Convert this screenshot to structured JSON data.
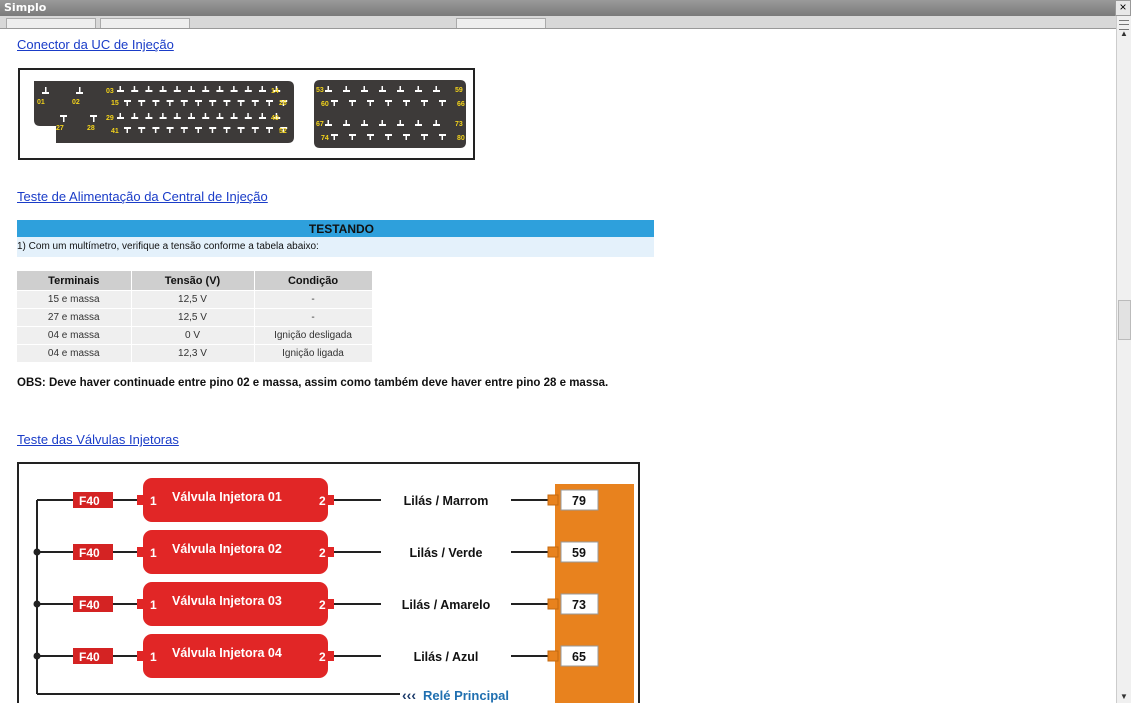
{
  "window": {
    "title": "Simplo",
    "close_label": "×"
  },
  "links": {
    "connector": "Conector da UC de Injeção",
    "power_test": "Teste de Alimentação da Central de Injeção",
    "injector_test": "Teste das Válvulas Injetoras"
  },
  "connector": {
    "left_labels": [
      "03",
      "14",
      "15",
      "26",
      "29",
      "40",
      "41",
      "52",
      "01",
      "02",
      "27",
      "28"
    ],
    "right_labels": [
      "53",
      "59",
      "60",
      "66",
      "67",
      "73",
      "74",
      "80"
    ]
  },
  "testing": {
    "header": "TESTANDO",
    "instruction": "1) Com um multímetro, verifique a tensão conforme a tabela abaixo:"
  },
  "voltage_table": {
    "headers": [
      "Terminais",
      "Tensão (V)",
      "Condição"
    ],
    "rows": [
      [
        "15 e massa",
        "12,5 V",
        "-"
      ],
      [
        "27 e massa",
        "12,5 V",
        "-"
      ],
      [
        "04 e massa",
        "0 V",
        "Ignição desligada"
      ],
      [
        "04 e massa",
        "12,3 V",
        "Ignição ligada"
      ]
    ]
  },
  "obs": "OBS: Deve haver continuade entre pino 02 e massa, assim como também deve haver entre pino 28 e massa.",
  "injectors": {
    "fuse": "F40",
    "pin_in": "1",
    "pin_out": "2",
    "rows": [
      {
        "name": "Válvula Injetora 01",
        "wire": "Lilás / Marrom",
        "pin": "79"
      },
      {
        "name": "Válvula Injetora 02",
        "wire": "Lilás / Verde",
        "pin": "59"
      },
      {
        "name": "Válvula Injetora 03",
        "wire": "Lilás / Amarelo",
        "pin": "73"
      },
      {
        "name": "Válvula Injetora 04",
        "wire": "Lilás / Azul",
        "pin": "65"
      }
    ],
    "relay": "Relé Principal",
    "relay_arrows": "‹‹‹"
  },
  "colors": {
    "link": "#1a3cc8",
    "header_bar": "#2ea0dc",
    "injector": "#e12626",
    "ecu": "#e8821e",
    "connector": "#3d3a39",
    "pin_label": "#f2d21b"
  }
}
